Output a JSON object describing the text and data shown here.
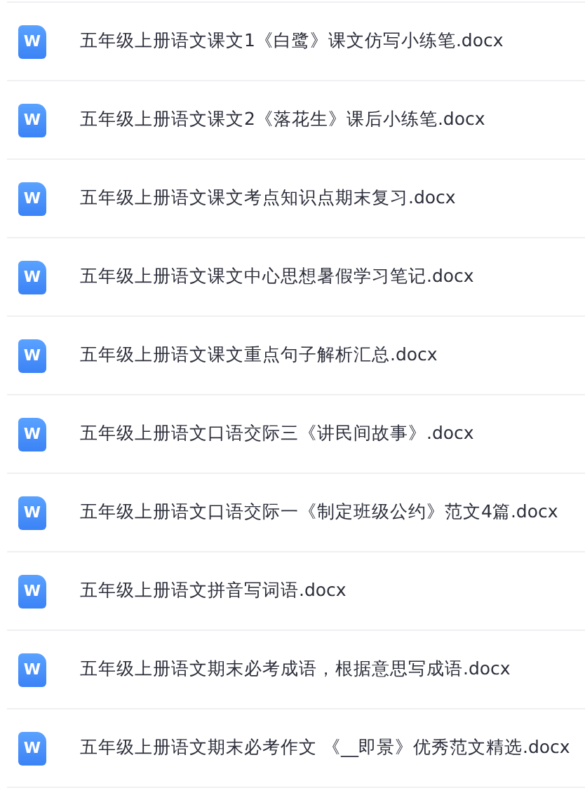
{
  "files": [
    {
      "icon_label": "W",
      "name": "五年级上册语文课文1《白鹭》课文仿写小练笔.docx"
    },
    {
      "icon_label": "W",
      "name": "五年级上册语文课文2《落花生》课后小练笔.docx"
    },
    {
      "icon_label": "W",
      "name": "五年级上册语文课文考点知识点期末复习.docx"
    },
    {
      "icon_label": "W",
      "name": "五年级上册语文课文中心思想暑假学习笔记.docx"
    },
    {
      "icon_label": "W",
      "name": "五年级上册语文课文重点句子解析汇总.docx"
    },
    {
      "icon_label": "W",
      "name": "五年级上册语文口语交际三《讲民间故事》.docx"
    },
    {
      "icon_label": "W",
      "name": "五年级上册语文口语交际一《制定班级公约》范文4篇.docx"
    },
    {
      "icon_label": "W",
      "name": "五年级上册语文拼音写词语.docx"
    },
    {
      "icon_label": "W",
      "name": "五年级上册语文期末必考成语，根据意思写成语.docx"
    },
    {
      "icon_label": "W",
      "name": "五年级上册语文期末必考作文 《__即景》优秀范文精选.docx"
    }
  ]
}
